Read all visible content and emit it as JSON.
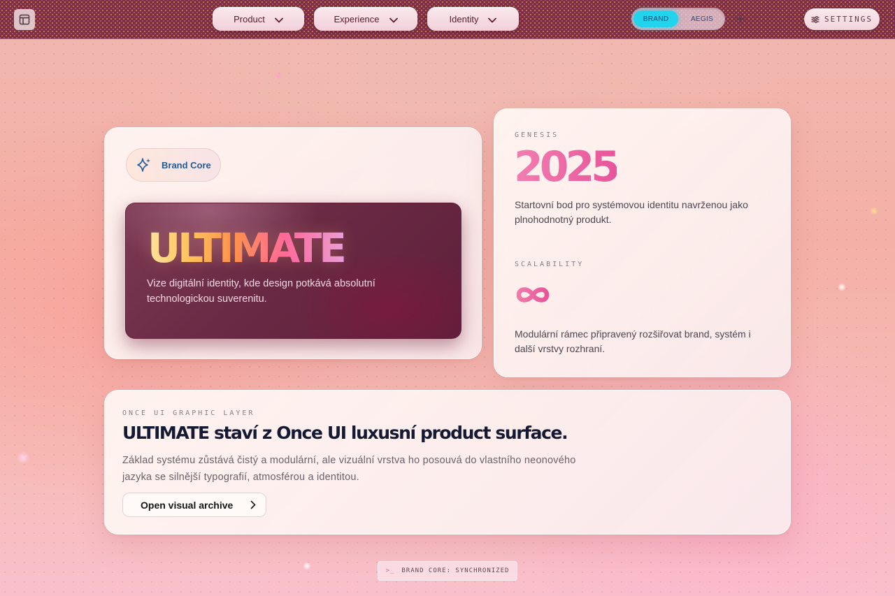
{
  "nav": {
    "items": [
      {
        "label": "Product"
      },
      {
        "label": "Experience"
      },
      {
        "label": "Identity"
      }
    ],
    "toggle": {
      "brand": "BRAND",
      "aegis": "AEGIS",
      "active": "BRAND"
    },
    "settings_label": "SETTINGS"
  },
  "hero": {
    "badge_label": "Brand Core",
    "headline": "ULTIMATE",
    "description": "Vize digitální identity, kde design potkává absolutní technologickou suverenitu."
  },
  "side": {
    "genesis_label": "GENESIS",
    "year": "2025",
    "genesis_text": "Startovní bod pro systémovou identitu navrženou jako plnohodnotný produkt.",
    "scalability_label": "SCALABILITY",
    "scalability_text": "Modulární rámec připravený rozšiřovat brand, systém i další vrstvy rozhraní."
  },
  "layer": {
    "label": "ONCE UI GRAPHIC LAYER",
    "title": "ULTIMATE staví z Once UI luxusní product surface.",
    "description": "Základ systému zůstává čistý a modulární, ale vizuální vrstva ho posouvá do vlastního neonového jazyka se silnější typografií, atmosférou a identitou.",
    "button_label": "Open visual archive"
  },
  "status": {
    "prompt": ">_",
    "text": "BRAND CORE: SYNCHRONIZED"
  },
  "colors": {
    "accent_cyan": "#22d3ee",
    "pink": "#e8559a",
    "topbar": "#7a2e3e",
    "navy": "#141a33"
  }
}
